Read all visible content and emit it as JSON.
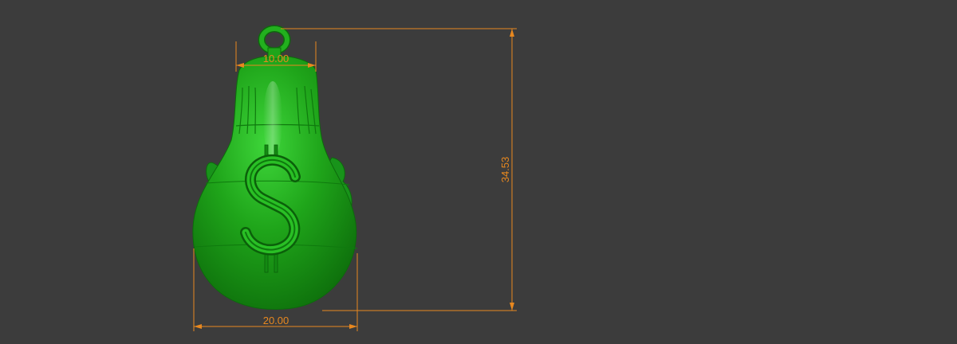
{
  "viewport": {
    "background": "#3c3c3c"
  },
  "model": {
    "color": "#1fa51a",
    "emboss_symbol": "dollar-sign"
  },
  "dimensions": {
    "color": "#e8881f",
    "top_width": "10.00",
    "bottom_width": "20.00",
    "height": "34.53"
  }
}
